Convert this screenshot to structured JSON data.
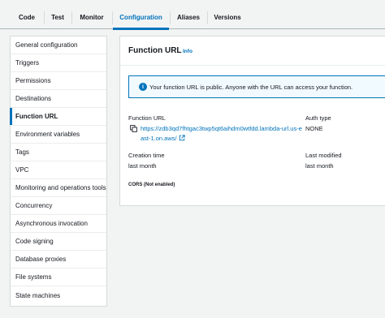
{
  "tabs": [
    {
      "label": "Code",
      "active": false
    },
    {
      "label": "Test",
      "active": false
    },
    {
      "label": "Monitor",
      "active": false
    },
    {
      "label": "Configuration",
      "active": true
    },
    {
      "label": "Aliases",
      "active": false
    },
    {
      "label": "Versions",
      "active": false
    }
  ],
  "sidebar": {
    "items": [
      {
        "label": "General configuration"
      },
      {
        "label": "Triggers"
      },
      {
        "label": "Permissions"
      },
      {
        "label": "Destinations"
      },
      {
        "label": "Function URL",
        "active": true
      },
      {
        "label": "Environment variables"
      },
      {
        "label": "Tags"
      },
      {
        "label": "VPC"
      },
      {
        "label": "Monitoring and operations tools"
      },
      {
        "label": "Concurrency"
      },
      {
        "label": "Asynchronous invocation"
      },
      {
        "label": "Code signing"
      },
      {
        "label": "Database proxies"
      },
      {
        "label": "File systems"
      },
      {
        "label": "State machines"
      }
    ]
  },
  "panel": {
    "title": "Function URL",
    "info": "Info",
    "alert_text": "Your function URL is public. Anyone with the URL can access your function.",
    "function_url_label": "Function URL",
    "function_url_value": "https://zdb3qd7fhtgac3twp5qt6aihdm0wtfdd.lambda-url.us-east-1.on.aws/",
    "auth_type_label": "Auth type",
    "auth_type_value": "NONE",
    "creation_time_label": "Creation time",
    "creation_time_value": "last month",
    "last_modified_label": "Last modified",
    "last_modified_value": "last month",
    "cors_label": "CORS (Not enabled)"
  },
  "colors": {
    "accent": "#0073bb",
    "background": "#f2f3f3",
    "info_alert_bg": "#f1faff"
  },
  "icons": {
    "alert": "info-circle-icon",
    "copy": "copy-icon",
    "external": "external-link-icon"
  }
}
